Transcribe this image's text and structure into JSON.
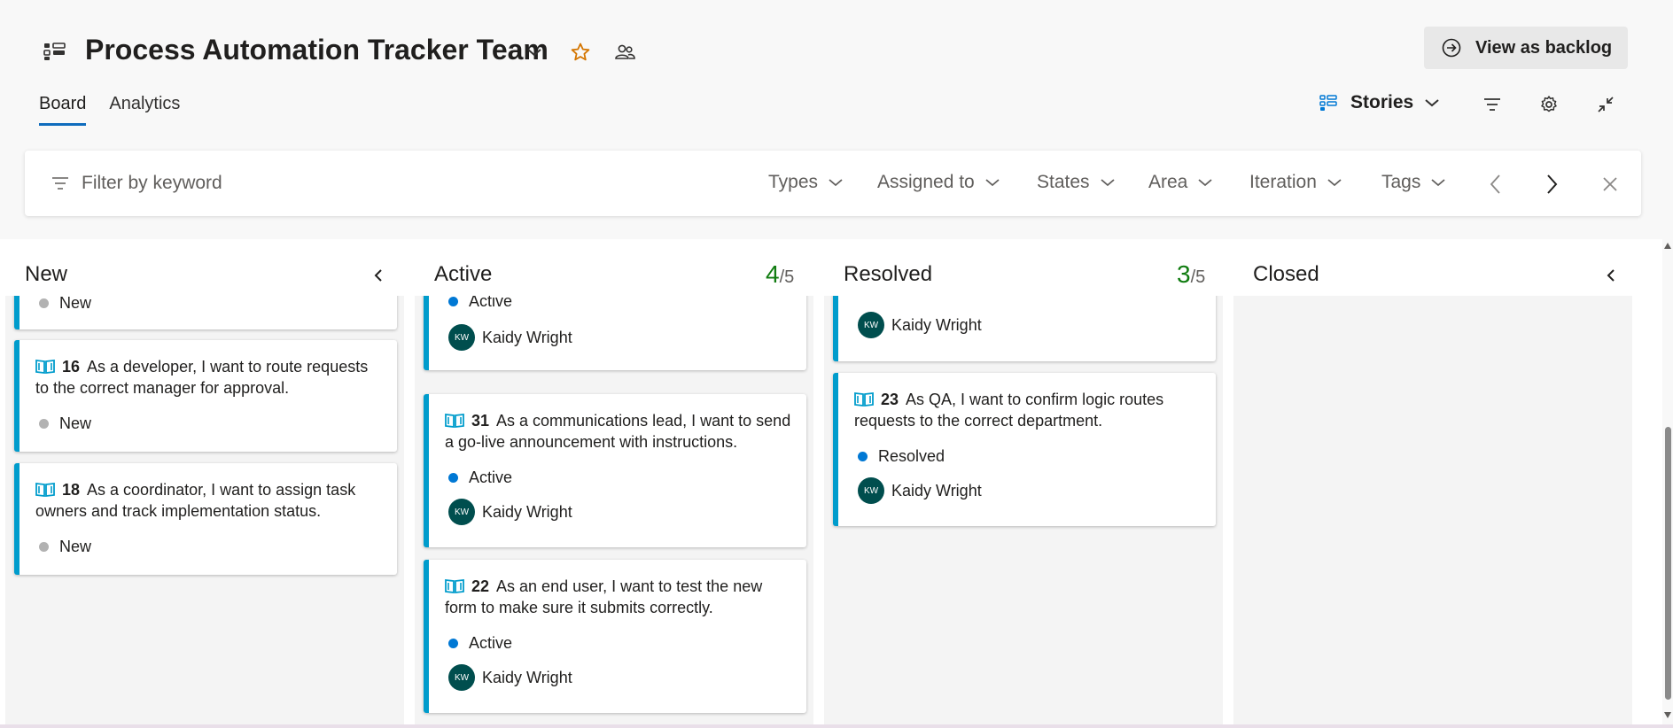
{
  "header": {
    "title": "Process Automation Tracker Team",
    "view_backlog_label": "View as backlog",
    "tabs": [
      "Board",
      "Analytics"
    ],
    "backlog_level": "Stories",
    "icons": [
      "board-icon",
      "chevron-down-icon",
      "star-icon",
      "team-icon",
      "arrow-right-circle-icon",
      "filter-icon",
      "gear-icon",
      "collapse-icon"
    ]
  },
  "filter": {
    "placeholder": "Filter by keyword",
    "dropdowns": [
      "Types",
      "Assigned to",
      "States",
      "Area",
      "Iteration",
      "Tags"
    ]
  },
  "colors": {
    "accent": "#0f6cbd",
    "card_border": "#009ccc",
    "count_ok": "#107c10",
    "state_new": "#b2b2b2",
    "state_active": "#0078d4",
    "avatar_bg": "#004e4e"
  },
  "columns": [
    {
      "title": "New",
      "count": "",
      "limit": "",
      "cards": [
        {
          "id": "",
          "title": "",
          "state": "New",
          "assignee": ""
        },
        {
          "id": "16",
          "title": "As a developer, I want to route requests to the correct manager for approval.",
          "state": "New",
          "assignee": ""
        },
        {
          "id": "18",
          "title": "As a coordinator, I want to assign task owners and track implementation status.",
          "state": "New",
          "assignee": ""
        }
      ]
    },
    {
      "title": "Active",
      "count": "4",
      "limit": "/5",
      "cards": [
        {
          "id": "",
          "title": "",
          "state": "Active",
          "assignee": "Kaidy Wright",
          "initials": "KW"
        },
        {
          "id": "31",
          "title": "As a communications lead, I want to send a go-live announcement with instructions.",
          "state": "Active",
          "assignee": "Kaidy Wright",
          "initials": "KW"
        },
        {
          "id": "22",
          "title": "As an end user, I want to test the new form to make sure it submits correctly.",
          "state": "Active",
          "assignee": "Kaidy Wright",
          "initials": "KW"
        }
      ]
    },
    {
      "title": "Resolved",
      "count": "3",
      "limit": "/5",
      "cards": [
        {
          "id": "",
          "title": "",
          "state": "",
          "assignee": "Kaidy Wright",
          "initials": "KW"
        },
        {
          "id": "23",
          "title": "As QA, I want to confirm logic routes requests to the correct department.",
          "state": "Resolved",
          "assignee": "Kaidy Wright",
          "initials": "KW"
        }
      ]
    },
    {
      "title": "Closed",
      "count": "",
      "limit": "",
      "cards": []
    }
  ]
}
